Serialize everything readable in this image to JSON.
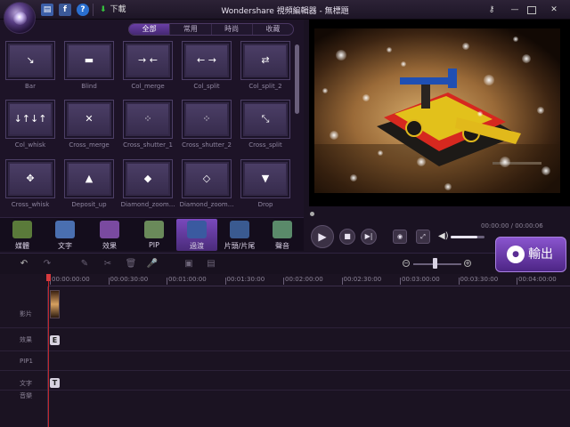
{
  "titlebar": {
    "title": "Wondershare 視頻編輯器 - 無標題",
    "download_label": "下載",
    "save_icon": "save-icon",
    "facebook_icon": "facebook-icon",
    "help_icon": "help-icon"
  },
  "transitions": {
    "filter_tabs": [
      "全部",
      "常用",
      "時尚",
      "收藏"
    ],
    "active_filter": "全部",
    "items": [
      {
        "label": "Bar",
        "sym": "↘"
      },
      {
        "label": "Blind",
        "sym": "▬"
      },
      {
        "label": "Col_merge",
        "sym": "→ ←"
      },
      {
        "label": "Col_split",
        "sym": "← →"
      },
      {
        "label": "Col_split_2",
        "sym": "⇄"
      },
      {
        "label": "Col_whisk",
        "sym": "↓↑↓↑"
      },
      {
        "label": "Cross_merge",
        "sym": "✕"
      },
      {
        "label": "Cross_shutter_1",
        "sym": "⁘"
      },
      {
        "label": "Cross_shutter_2",
        "sym": "⁘"
      },
      {
        "label": "Cross_split",
        "sym": "⤡"
      },
      {
        "label": "Cross_whisk",
        "sym": "✥"
      },
      {
        "label": "Deposit_up",
        "sym": "▲"
      },
      {
        "label": "Diamond_zoom...",
        "sym": "◆"
      },
      {
        "label": "Diamond_zoom...",
        "sym": "◇"
      },
      {
        "label": "Drop",
        "sym": "▼"
      }
    ]
  },
  "media_tabs": [
    {
      "label": "媒體",
      "icon": "media-icon",
      "color": "#5a7a3a"
    },
    {
      "label": "文字",
      "icon": "text-icon",
      "color": "#4a6fb0"
    },
    {
      "label": "效果",
      "icon": "effects-icon",
      "color": "#7a4aa0"
    },
    {
      "label": "PIP",
      "icon": "pip-icon",
      "color": "#6a8a5a"
    },
    {
      "label": "過渡",
      "icon": "transition-icon",
      "color": "#3a5aa0",
      "active": true
    },
    {
      "label": "片頭/片尾",
      "icon": "intro-credit-icon",
      "color": "#3a5a90"
    },
    {
      "label": "聲音",
      "icon": "sound-icon",
      "color": "#5a8a6a"
    }
  ],
  "preview": {
    "time": "00:00:00 / 00:00:06",
    "volume_fraction": 0.8
  },
  "export": {
    "label": "輸出"
  },
  "timeline": {
    "ticks": [
      "00:00:00:00",
      "00:00:30:00",
      "00:01:00:00",
      "00:01:30:00",
      "00:02:00:00",
      "00:02:30:00",
      "00:03:00:00",
      "00:03:30:00",
      "00:04:00:00"
    ],
    "tracks": [
      "影片",
      "效果",
      "PIP1",
      "文字",
      "音樂"
    ],
    "effect_marker": "E",
    "text_marker": "T",
    "zoom_fraction": 0.4
  }
}
